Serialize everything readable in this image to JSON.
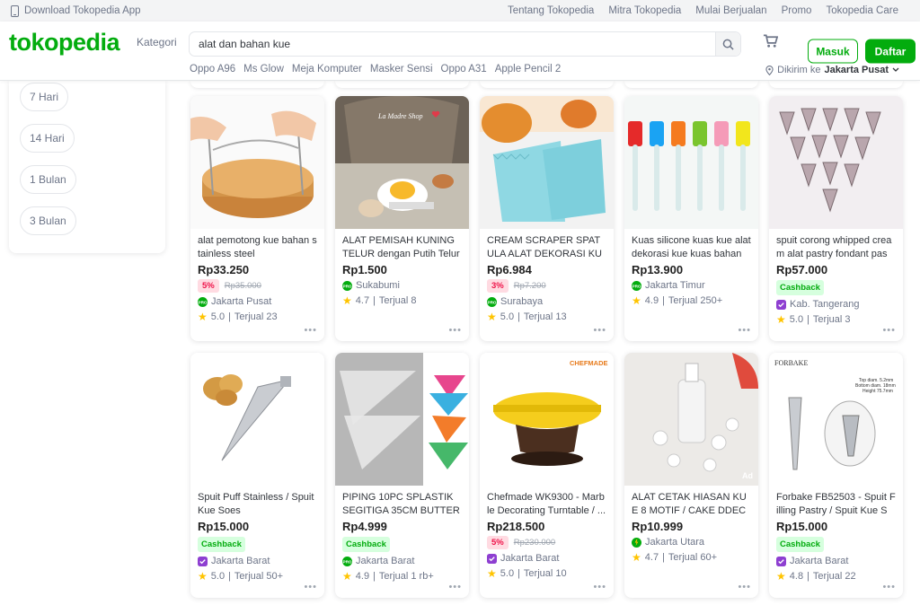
{
  "topbar": {
    "app_label": "Download Tokopedia App",
    "links": [
      "Tentang Tokopedia",
      "Mitra Tokopedia",
      "Mulai Berjualan",
      "Promo",
      "Tokopedia Care"
    ]
  },
  "header": {
    "logo": "tokopedia",
    "kategori": "Kategori",
    "search_value": "alat dan bahan kue",
    "masuk": "Masuk",
    "daftar": "Daftar",
    "suggestions": [
      "Oppo A96",
      "Ms Glow",
      "Meja Komputer",
      "Masker Sensi",
      "Oppo A31",
      "Apple Pencil 2"
    ],
    "dikirim_prefix": "Dikirim ke",
    "dikirim_city": "Jakarta Pusat"
  },
  "sidebar": {
    "chips": [
      "7 Hari",
      "14 Hari",
      "1 Bulan",
      "3 Bulan"
    ]
  },
  "products": [
    {
      "name": "alat pemotong kue bahan stainless steel",
      "price": "Rp33.250",
      "discount": "5%",
      "old_price": "Rp35.000",
      "cashback": "",
      "badge": "pro",
      "location": "Jakarta Pusat",
      "rating": "5.0",
      "sold": "Terjual 23",
      "ad": ""
    },
    {
      "name": "ALAT PEMISAH KUNING TELUR dengan Putih Telur ut...",
      "price": "Rp1.500",
      "discount": "",
      "old_price": "",
      "cashback": "",
      "badge": "pro",
      "location": "Sukabumi",
      "rating": "4.7",
      "sold": "Terjual 8",
      "ad": "",
      "img_text": "La Madre Shop"
    },
    {
      "name": "CREAM SCRAPER SPATULA ALAT DEKORASI KUE SE...",
      "price": "Rp6.984",
      "discount": "3%",
      "old_price": "Rp7.200",
      "cashback": "",
      "badge": "pro",
      "location": "Surabaya",
      "rating": "5.0",
      "sold": "Terjual 13",
      "ad": ""
    },
    {
      "name": "Kuas silicone kuas kue alat dekorasi kue kuas bahan ...",
      "price": "Rp13.900",
      "discount": "",
      "old_price": "",
      "cashback": "",
      "badge": "pro",
      "location": "Jakarta Timur",
      "rating": "4.9",
      "sold": "Terjual 250+",
      "ad": ""
    },
    {
      "name": "spuit corong whipped cream alat pastry fondant past...",
      "price": "Rp57.000",
      "discount": "",
      "old_price": "",
      "cashback": "Cashback",
      "badge": "official",
      "location": "Kab. Tangerang",
      "rating": "5.0",
      "sold": "Terjual 3",
      "ad": ""
    },
    {
      "name": "Spuit Puff Stainless / Spuit Kue Soes",
      "price": "Rp15.000",
      "discount": "",
      "old_price": "",
      "cashback": "Cashback",
      "badge": "official",
      "location": "Jakarta Barat",
      "rating": "5.0",
      "sold": "Terjual 50+",
      "ad": "Ad"
    },
    {
      "name": "PIPING 10PC SPLASTIK SEGITIGA 35CM BUTTERCR...",
      "price": "Rp4.999",
      "discount": "",
      "old_price": "",
      "cashback": "Cashback",
      "badge": "pro",
      "location": "Jakarta Barat",
      "rating": "4.9",
      "sold": "Terjual 1 rb+",
      "ad": "Ad"
    },
    {
      "name": "Chefmade WK9300 - Marble Decorating Turntable / ...",
      "price": "Rp218.500",
      "discount": "5%",
      "old_price": "Rp230.000",
      "cashback": "",
      "badge": "official",
      "location": "Jakarta Barat",
      "rating": "5.0",
      "sold": "Terjual 10",
      "ad": "Ad",
      "img_text": "CHEFMADE"
    },
    {
      "name": "ALAT CETAK HIASAN KUE 8 MOTIF / CAKE DDECORA...",
      "price": "Rp10.999",
      "discount": "",
      "old_price": "",
      "cashback": "",
      "badge": "power",
      "location": "Jakarta Utara",
      "rating": "4.7",
      "sold": "Terjual 60+",
      "ad": "Ad"
    },
    {
      "name": "Forbake FB52503 - Spuit Filling Pastry / Spuit Kue So...",
      "price": "Rp15.000",
      "discount": "",
      "old_price": "",
      "cashback": "Cashback",
      "badge": "official",
      "location": "Jakarta Barat",
      "rating": "4.8",
      "sold": "Terjual 22",
      "ad": "Ad",
      "img_text": "FORBAKE",
      "img_text2": "Top diam. 5.2mm",
      "img_text3": "Bottom diam. 18mm",
      "img_text4": "Height 75.7mm"
    }
  ],
  "colors": {
    "brand": "#03ac0e",
    "discount": "#ef144a",
    "star": "#ffc400"
  }
}
